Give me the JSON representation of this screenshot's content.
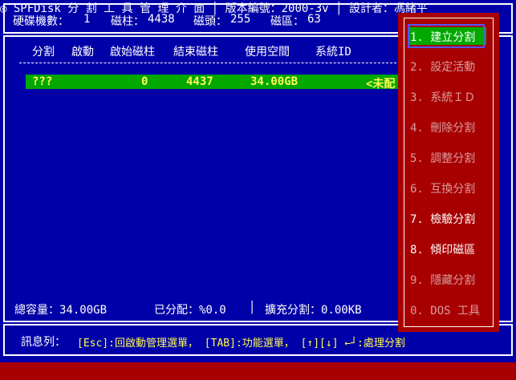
{
  "header": {
    "disk_label": "硬碟機數：",
    "disk_value": "1",
    "cyl_label": "磁柱：",
    "cyl_value": "4438",
    "head_label": "磁頭：",
    "head_value": "255",
    "sector_label": "磁區：",
    "sector_value": "63"
  },
  "table": {
    "columns": [
      "分割",
      "啟動",
      "啟始磁柱",
      "結束磁柱",
      "使用空間",
      "系統ID"
    ],
    "rows": [
      {
        "part": "???",
        "boot": "",
        "start": "0",
        "end": "4437",
        "size": "34.00GB",
        "sysid": "<未配"
      }
    ]
  },
  "menu": {
    "items": [
      "1. 建立分割",
      "2. 設定活動",
      "3. 系統ＩＤ",
      "4. 刪除分割",
      "5. 調整分割",
      "6. 互換分割",
      "7. 檢驗分割",
      "8. 傾印磁區",
      "9. 隱藏分割",
      "0. DOS 工具"
    ]
  },
  "status": {
    "total": "總容量：34.00GB",
    "allocated": "已分配：%0.0",
    "separator": "│",
    "extended": "擴充分割：0.00KB"
  },
  "message": {
    "label": "訊息列：",
    "text": "[Esc]:回啟動管理選單， [TAB]:功能選單， [↑][↓] ←┘:處理分割"
  },
  "bottom": {
    "app": "◎ SPFDisk 分 割 工 具 管 理 介 面",
    "sep1": "│",
    "version": "版本編號：2000-3v",
    "sep2": "│",
    "author": "設計者：馮緒平"
  }
}
